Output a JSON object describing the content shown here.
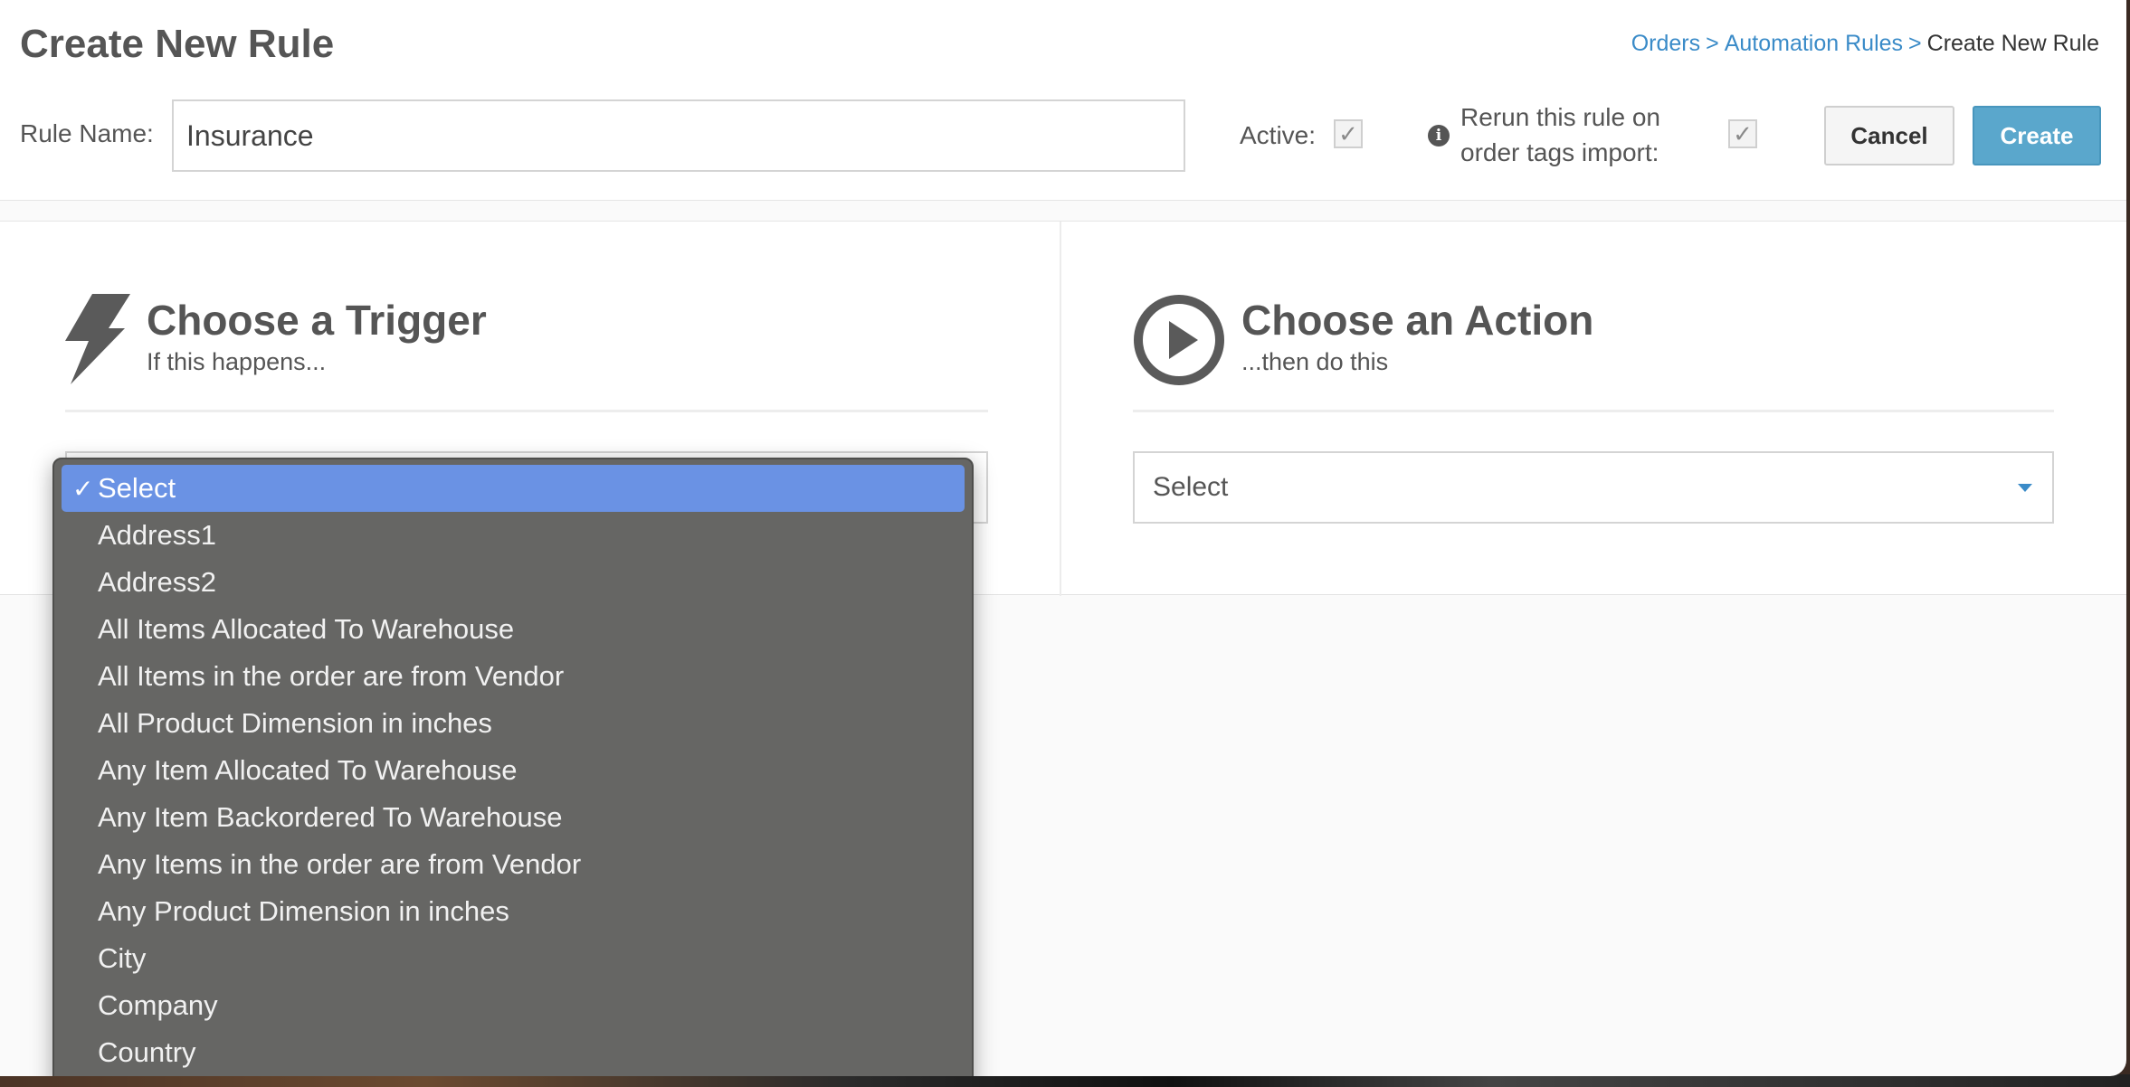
{
  "header": {
    "title": "Create New Rule",
    "breadcrumb": {
      "orders": "Orders",
      "automation_rules": "Automation Rules",
      "separator": ">",
      "current": "Create New Rule"
    },
    "rule_name_label": "Rule Name:",
    "rule_name_value": "Insurance",
    "active_label": "Active:",
    "active_checked_glyph": "✓",
    "rerun_label": "Rerun this rule on order tags import:",
    "rerun_checked_glyph": "✓",
    "info_icon_glyph": "i",
    "cancel_label": "Cancel",
    "create_label": "Create"
  },
  "trigger": {
    "title": "Choose a Trigger",
    "subtitle": "If this happens...",
    "icon": "lightning-bolt-icon"
  },
  "action": {
    "title": "Choose an Action",
    "subtitle": "...then do this",
    "icon": "play-circle-icon",
    "select_value": "Select"
  },
  "trigger_dropdown": {
    "check_glyph": "✓",
    "items": [
      "Select",
      "Address1",
      "Address2",
      "All Items Allocated To Warehouse",
      "All Items in the order are from Vendor",
      "All Product Dimension in inches",
      "Any Item Allocated To Warehouse",
      "Any Item Backordered To Warehouse",
      "Any Items in the order are from Vendor",
      "Any Product Dimension in inches",
      "City",
      "Company",
      "Country"
    ]
  },
  "colors": {
    "link": "#3a8bc8",
    "create_button": "#5aa7cc",
    "dropdown_background": "#666664",
    "dropdown_selected": "#6a92e4"
  }
}
